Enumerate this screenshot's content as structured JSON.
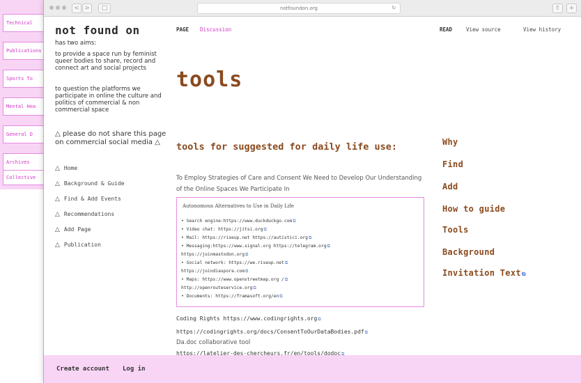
{
  "background_window": {
    "tabs": [
      "Technical",
      "Publications",
      "Sports To",
      "Mental Hea",
      "General D",
      "Archives",
      "Collective"
    ]
  },
  "browser": {
    "url": "notfoundon.org",
    "nav_back": "<",
    "nav_forward": ">",
    "sidebar_toggle": "□",
    "share": "⇧",
    "new_tab": "+"
  },
  "site": {
    "logo": "not found on",
    "intro": "has two aims:",
    "aim1": "to provide a space run by feminist queer bodies to share, record and connect art and social projects",
    "aim2": "to question the platforms we participate in online the culture and politics of commercial & non commercial space",
    "warning": "△ please do not share this page on commercial social media △",
    "nav": [
      {
        "label": "Home"
      },
      {
        "label": "Background & Guide"
      },
      {
        "label": "Find & Add Events"
      },
      {
        "label": "Recommendations"
      },
      {
        "label": "Add Page"
      },
      {
        "label": "Publication"
      }
    ],
    "nav_marker": "△"
  },
  "tabs": {
    "page": "PAGE",
    "discussion": "Discussion",
    "read": "READ",
    "view_source": "View source",
    "view_history": "View history"
  },
  "content": {
    "title": "tools",
    "heading": "tools for suggested for daily life use:",
    "subtitle": "To Employ Strategies of Care and Consent We Need to Develop Our Understanding of the Online Spaces We Participate In",
    "box_title": "Autonomous Alternatives to Use in Daily Life",
    "box_lines": [
      "• Search engine:https://www.duckduckgo.com",
      "• Video chat: https://jitsi.org",
      "• Mail: https://riseup.net https://autistici.org",
      "• Messaging:https://www.signal.org https://telegram.org",
      "https://joinmastodon.org",
      "• Social network: https://we.riseup.net",
      "https://joindiaspora.com",
      "• Maps: https://www.openstreetmap.org /",
      "http://openrouteservice.org",
      "• Documents: https://framasoft.org/en"
    ],
    "coding_rights": "Coding Rights https://www.codingrights.org",
    "pdf_link": "https://codingrights.org/docs/ConsentToOurDataBodies.pdf",
    "dadoc": "Da.doc collaborative tool",
    "dadoc_link": "https://latelier-des-chercheurs.fr/en/tools/dodoc"
  },
  "right_nav": [
    "Why",
    "Find",
    "Add",
    "How to guide",
    "Tools",
    "Background",
    "Invitation Text"
  ],
  "footer": {
    "create_account": "Create account",
    "log_in": "Log in"
  },
  "colors": {
    "accent_pink": "#e58ae0",
    "heading_brown": "#8a4a1e",
    "link_magenta": "#d234c6",
    "footer_bg": "#f9d5f5"
  }
}
